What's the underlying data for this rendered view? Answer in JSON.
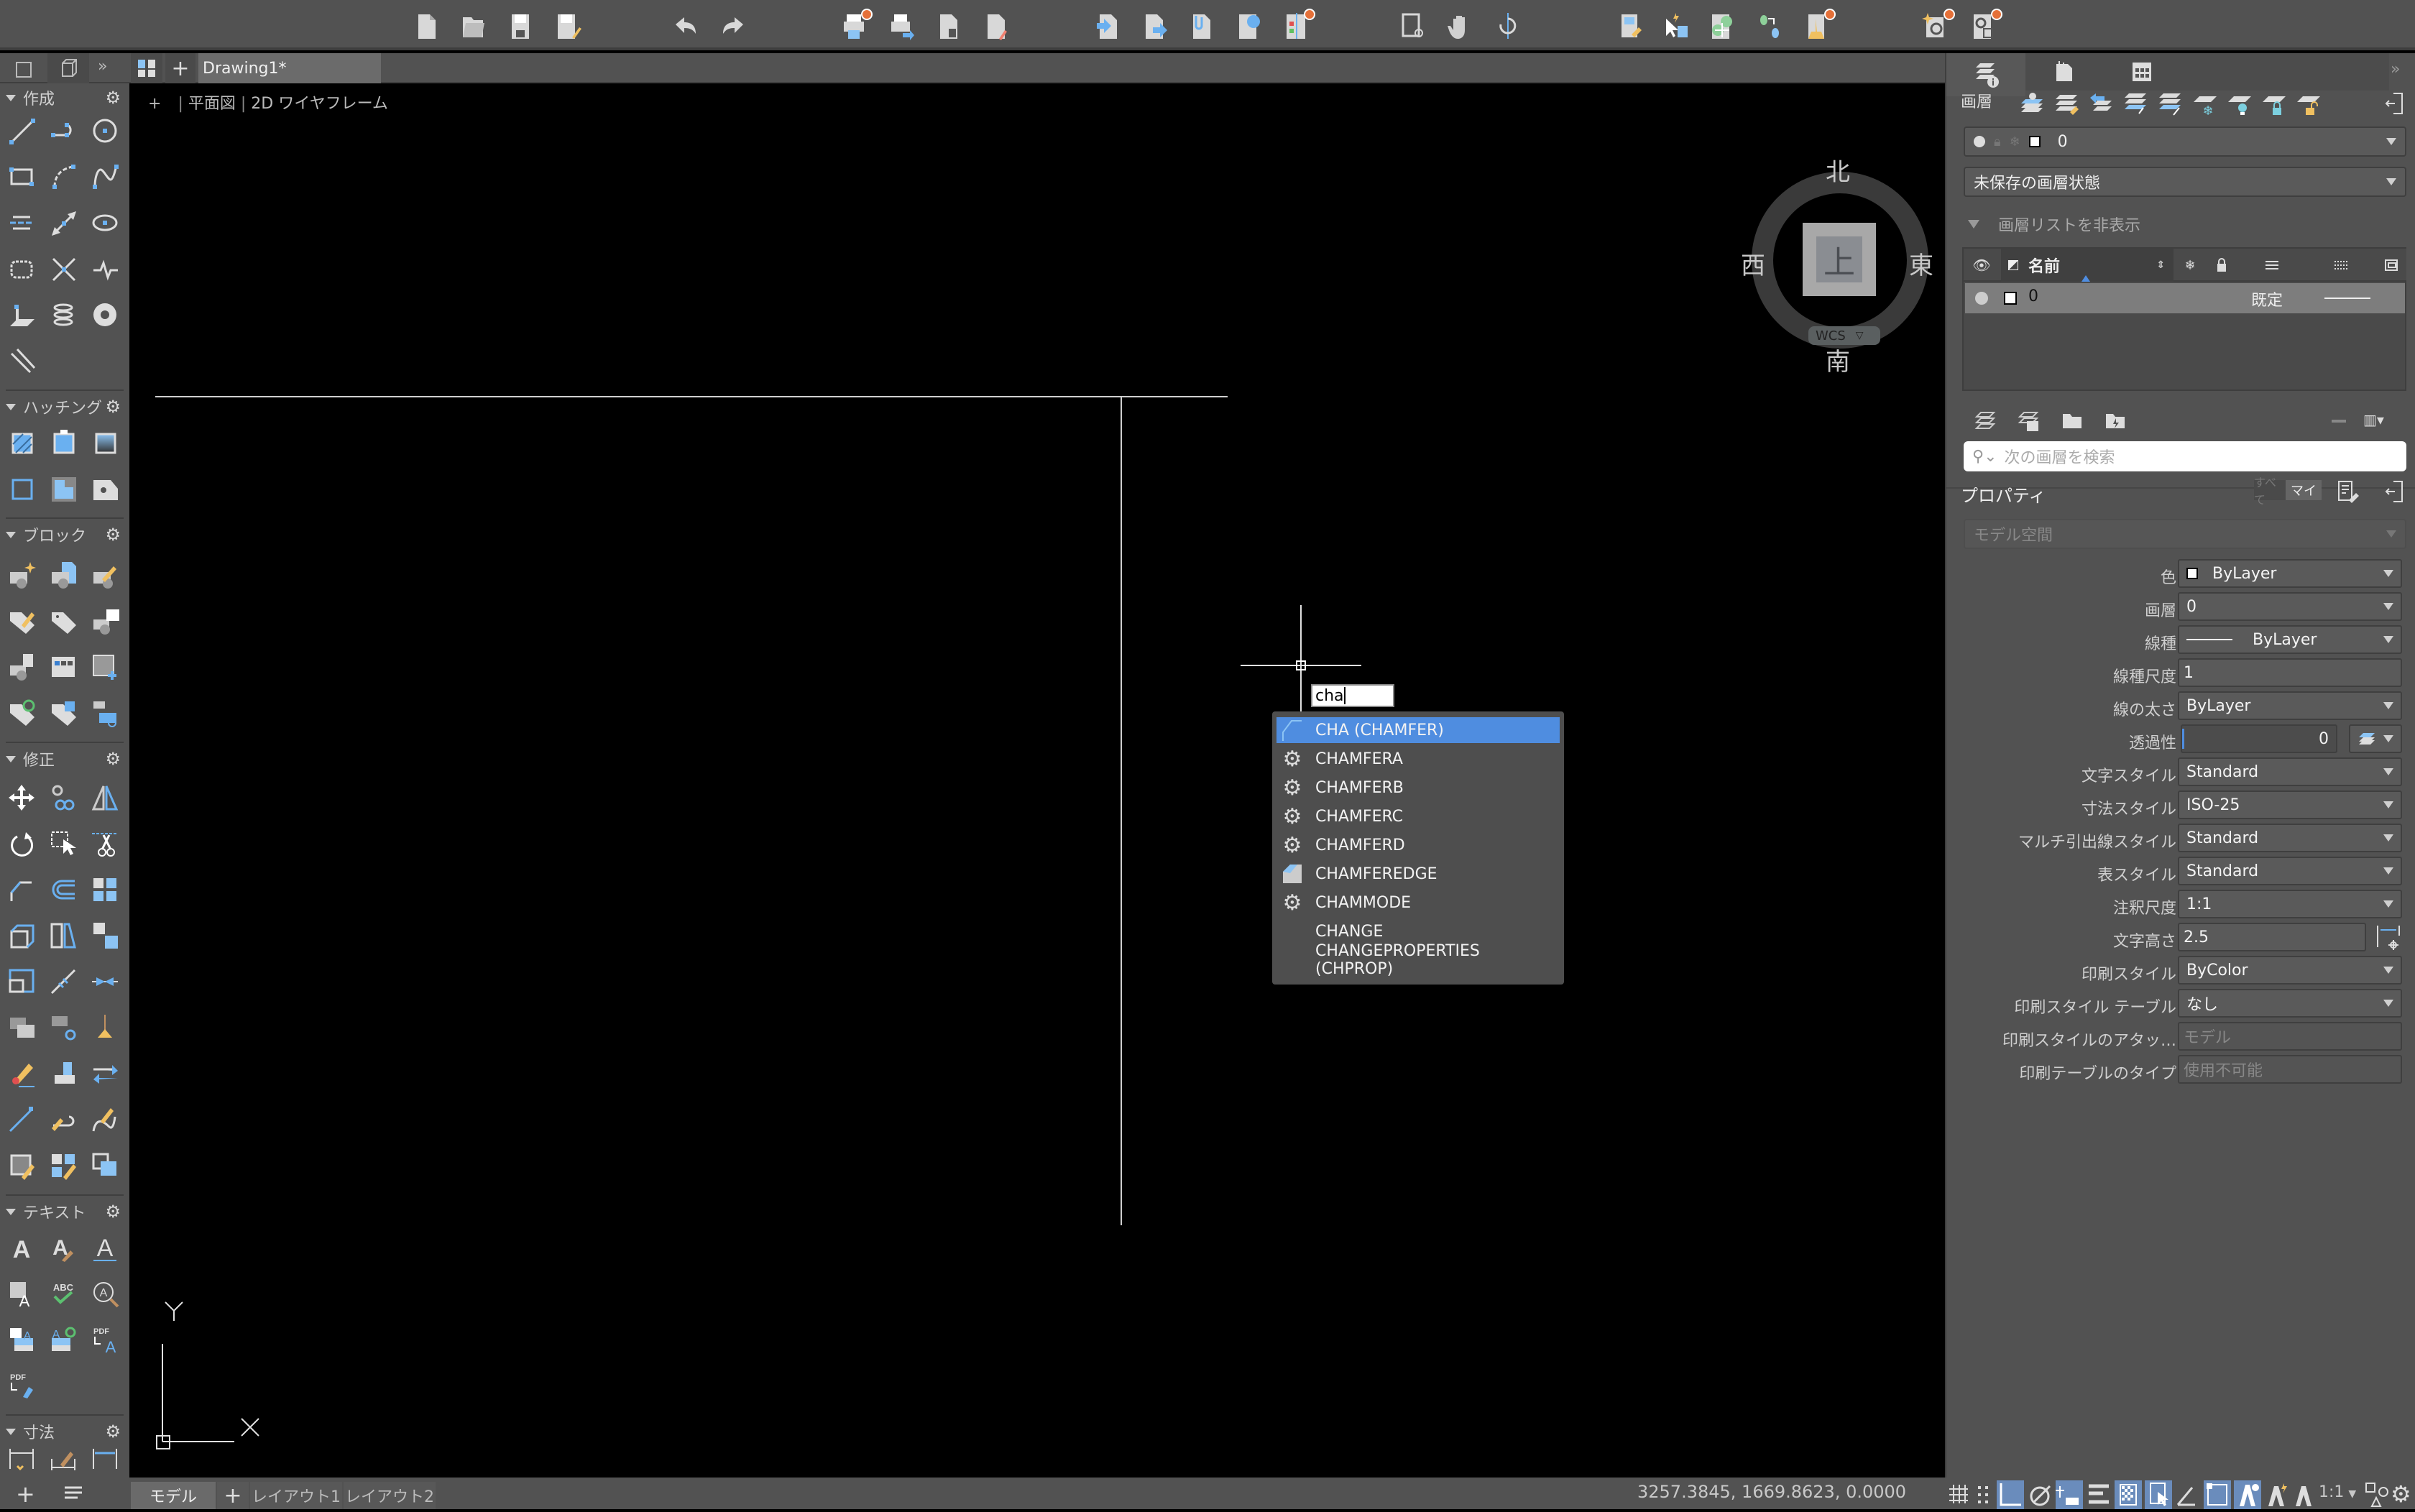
{
  "app": {
    "document_tab": "Drawing1*",
    "viewport_label": {
      "plus": "+",
      "view": "平面図",
      "visual_style": "2D ワイヤフレーム"
    }
  },
  "toolbar": {
    "icons": [
      "new-file",
      "open-file",
      "save",
      "save-as",
      "undo",
      "redo",
      "plot",
      "batch-plot",
      "page-setup",
      "publish",
      "import",
      "export",
      "attach",
      "etransmit",
      "compare",
      "zoom-window",
      "pan",
      "orbit",
      "match-properties",
      "quick-select",
      "snap-settings",
      "layer-walk",
      "purge",
      "find-replace",
      "drawing-recovery"
    ]
  },
  "left_panel": {
    "sections": [
      {
        "title": "作成"
      },
      {
        "title": "ハッチング"
      },
      {
        "title": "ブロック"
      },
      {
        "title": "修正"
      },
      {
        "title": "テキスト"
      },
      {
        "title": "寸法"
      }
    ]
  },
  "viewcube": {
    "north": "北",
    "south": "南",
    "east": "東",
    "west": "西",
    "face": "上",
    "ucs": "WCS"
  },
  "command": {
    "input_value": "cha",
    "suggestions": [
      {
        "label": "CHA (CHAMFER)",
        "icon": "chamfer-icon",
        "selected": true
      },
      {
        "label": "CHAMFERA",
        "icon": "sysvar-gear-icon"
      },
      {
        "label": "CHAMFERB",
        "icon": "sysvar-gear-icon"
      },
      {
        "label": "CHAMFERC",
        "icon": "sysvar-gear-icon"
      },
      {
        "label": "CHAMFERD",
        "icon": "sysvar-gear-icon"
      },
      {
        "label": "CHAMFEREDGE",
        "icon": "chamfer-edge-icon"
      },
      {
        "label": "CHAMMODE",
        "icon": "sysvar-gear-icon"
      },
      {
        "label": "CHANGE",
        "icon": ""
      },
      {
        "label": "CHANGEPROPERTIES (CHPROP)",
        "icon": ""
      }
    ]
  },
  "ucs_icon": {
    "x": "X",
    "y": "Y"
  },
  "layout_tabs": {
    "model": "モデル",
    "add": "+",
    "layout1": "レイアウト1",
    "layout2": "レイアウト2"
  },
  "status": {
    "coordinates": "3257.3845, 1669.8623, 0.0000",
    "annotation_scale": "1:1"
  },
  "right_panel": {
    "layers": {
      "title": "画層",
      "current_layer": "0",
      "layer_state": "未保存の画層状態",
      "toggle_list_label": "画層リストを非表示",
      "column_name": "名前",
      "rows": [
        {
          "name": "0",
          "linetype": "既定"
        }
      ],
      "search_placeholder": "次の画層を検索"
    },
    "properties": {
      "title": "プロパティ",
      "filter_all": "すべて",
      "filter_mine": "マイ",
      "space": "モデル空間",
      "rows": [
        {
          "label": "色",
          "value": "ByLayer",
          "type": "dropdown",
          "swatch": true
        },
        {
          "label": "画層",
          "value": "0",
          "type": "dropdown"
        },
        {
          "label": "線種",
          "value": "ByLayer",
          "type": "dropdown",
          "line": true
        },
        {
          "label": "線種尺度",
          "value": "1",
          "type": "input"
        },
        {
          "label": "線の太さ",
          "value": "ByLayer",
          "type": "dropdown"
        },
        {
          "label": "透過性",
          "value": "0",
          "type": "slider"
        },
        {
          "label": "文字スタイル",
          "value": "Standard",
          "type": "dropdown"
        },
        {
          "label": "寸法スタイル",
          "value": "ISO-25",
          "type": "dropdown"
        },
        {
          "label": "マルチ引出線スタイル",
          "value": "Standard",
          "type": "dropdown"
        },
        {
          "label": "表スタイル",
          "value": "Standard",
          "type": "dropdown"
        },
        {
          "label": "注釈尺度",
          "value": "1:1",
          "type": "dropdown"
        },
        {
          "label": "文字高さ",
          "value": "2.5",
          "type": "input-pick"
        },
        {
          "label": "印刷スタイル",
          "value": "ByColor",
          "type": "dropdown"
        },
        {
          "label": "印刷スタイル テーブル",
          "value": "なし",
          "type": "dropdown"
        },
        {
          "label": "印刷スタイルのアタッ…",
          "value": "モデル",
          "type": "disabled"
        },
        {
          "label": "印刷テーブルのタイプ",
          "value": "使用不可能",
          "type": "disabled"
        }
      ]
    }
  },
  "colors": {
    "accent": "#4f8de0",
    "panel": "#525252",
    "canvas": "#000000",
    "badge": "#e57038"
  }
}
